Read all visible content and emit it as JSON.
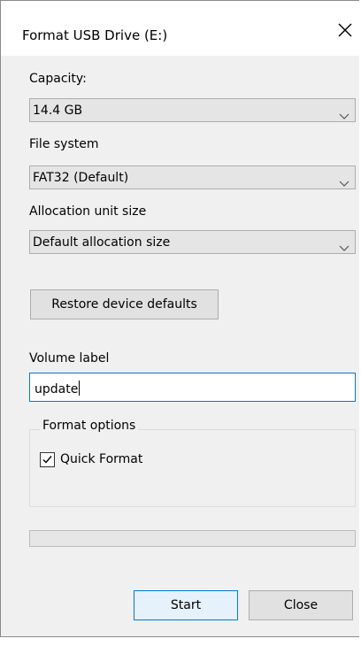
{
  "window": {
    "title": "Format USB Drive (E:)"
  },
  "capacity": {
    "label": "Capacity:",
    "selected": "14.4 GB"
  },
  "file_system": {
    "label": "File system",
    "selected": "FAT32 (Default)"
  },
  "allocation_unit": {
    "label": "Allocation unit size",
    "selected": "Default allocation size"
  },
  "restore_defaults_label": "Restore device defaults",
  "volume_label": {
    "label": "Volume label",
    "value": "update"
  },
  "format_options": {
    "title": "Format options",
    "quick_format_label": "Quick Format",
    "quick_format_checked": true
  },
  "progress": {
    "value": 0
  },
  "buttons": {
    "start": "Start",
    "close": "Close"
  },
  "colors": {
    "accent": "#0078d7",
    "dialog_bg": "#f0f0f0",
    "button_bg": "#e1e1e1"
  }
}
